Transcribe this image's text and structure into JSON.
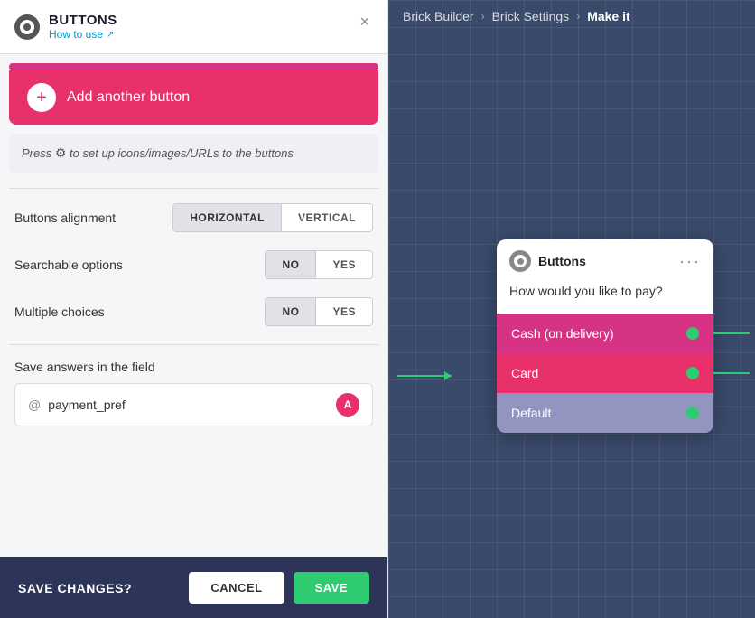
{
  "header": {
    "title": "BUTTONS",
    "subtitle": "How to use",
    "close_label": "×"
  },
  "add_button": {
    "label": "Add another button"
  },
  "hint": {
    "text_before": "Press",
    "gear_symbol": "⚙",
    "text_after": " to set up icons/images/URLs to the buttons"
  },
  "alignment": {
    "label": "Buttons alignment",
    "options": [
      "HORIZONTAL",
      "VERTICAL"
    ],
    "active": "HORIZONTAL"
  },
  "searchable": {
    "label": "Searchable options",
    "options": [
      "NO",
      "YES"
    ],
    "active": "NO"
  },
  "multiple": {
    "label": "Multiple choices",
    "options": [
      "NO",
      "YES"
    ],
    "active": "NO"
  },
  "save_field": {
    "label": "Save answers in the field",
    "at_sign": "@",
    "field_name": "payment_pref",
    "badge": "A"
  },
  "footer": {
    "question": "SAVE CHANGES?",
    "cancel_label": "CANCEL",
    "save_label": "SAVE"
  },
  "breadcrumb": {
    "builder": "Brick Builder",
    "separator1": "›",
    "settings": "Brick Settings",
    "separator2": "›",
    "make_it": "Make it"
  },
  "brick_card": {
    "title": "Buttons",
    "question": "How would you like to pay?",
    "options": [
      {
        "label": "Cash (on delivery)",
        "style": "cash"
      },
      {
        "label": "Card",
        "style": "card"
      },
      {
        "label": "Default",
        "style": "default"
      }
    ],
    "menu": "···"
  }
}
